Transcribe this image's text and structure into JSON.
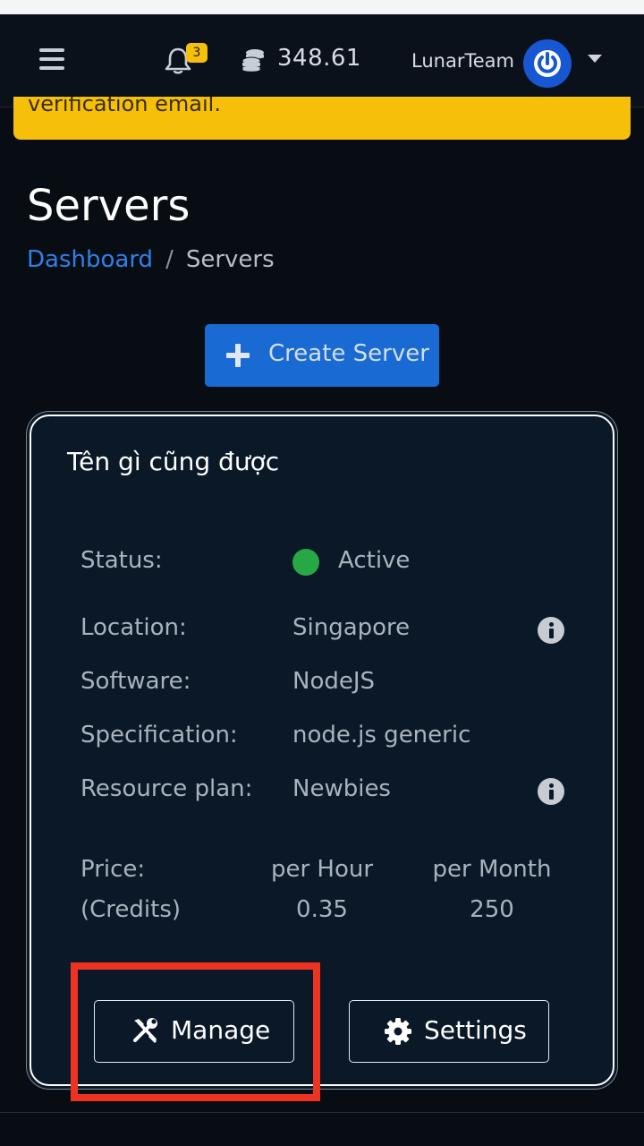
{
  "navbar": {
    "notification_count": "3",
    "credits": "348.61",
    "username": "LunarTeam"
  },
  "alert": {
    "text": "verification email."
  },
  "page": {
    "title": "Servers",
    "breadcrumb": {
      "link": "Dashboard",
      "separator": "/",
      "current": "Servers"
    },
    "create_button": "Create Server"
  },
  "server_card": {
    "name": "Tên gì cũng được",
    "rows": {
      "status": {
        "label": "Status:",
        "value": "Active",
        "color": "#28a745"
      },
      "location": {
        "label": "Location:",
        "value": "Singapore"
      },
      "software": {
        "label": "Software:",
        "value": "NodeJS"
      },
      "specification": {
        "label": "Specification:",
        "value": "node.js generic"
      },
      "resource_plan": {
        "label": "Resource plan:",
        "value": "Newbies"
      }
    },
    "price": {
      "label_line1": "Price:",
      "label_line2": "(Credits)",
      "hour_header": "per Hour",
      "hour_value": "0.35",
      "month_header": "per Month",
      "month_value": "250"
    },
    "buttons": {
      "manage": "Manage",
      "settings": "Settings"
    }
  },
  "colors": {
    "accent": "#1a6ad3",
    "alert": "#f5bf0a",
    "highlight": "#ee3322"
  }
}
